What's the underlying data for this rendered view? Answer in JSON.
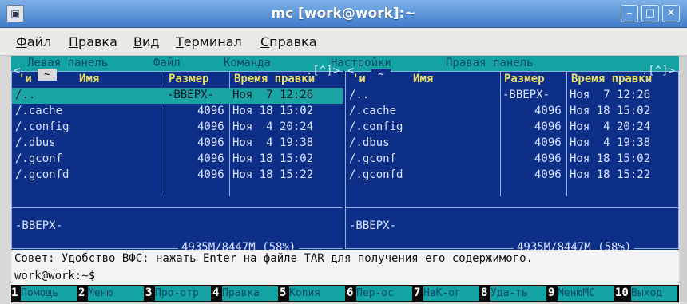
{
  "window": {
    "title": "mc [work@work]:~",
    "buttons": [
      "–",
      "□",
      "✕"
    ]
  },
  "menubar": {
    "items": [
      "Файл",
      "Правка",
      "Вид",
      "Терминал",
      "Справка"
    ]
  },
  "mc_menu": {
    "items": [
      "Левая панель",
      "Файл",
      "Команда",
      "Настройки",
      "Правая панель"
    ]
  },
  "left_panel": {
    "path_tab": "~",
    "title_right": ".[^]>",
    "headers": {
      "n": "'и",
      "name": "Имя",
      "size": "Размер",
      "time": "Время правки"
    },
    "rows": [
      {
        "name": "/..",
        "size": "-BBEPX-",
        "date": "Ноя  7 12:26",
        "selected": true
      },
      {
        "name": "/.cache",
        "size": "4096",
        "date": "Ноя 18 15:02"
      },
      {
        "name": "/.config",
        "size": "4096",
        "date": "Ноя  4 20:24"
      },
      {
        "name": "/.dbus",
        "size": "4096",
        "date": "Ноя  4 19:38"
      },
      {
        "name": "/.gconf",
        "size": "4096",
        "date": "Ноя 18 15:02"
      },
      {
        "name": "/.gconfd",
        "size": "4096",
        "date": "Ноя 18 15:22"
      }
    ],
    "status": "-BBEPX-",
    "disk": "4935M/8447M (58%)"
  },
  "right_panel": {
    "path_tab": "~",
    "title_right": ".[^]>",
    "headers": {
      "n": "'и",
      "name": "Имя",
      "size": "Размер",
      "time": "Время правки"
    },
    "rows": [
      {
        "name": "/..",
        "size": "-BBEPX-",
        "date": "Ноя  7 12:26"
      },
      {
        "name": "/.cache",
        "size": "4096",
        "date": "Ноя 18 15:02"
      },
      {
        "name": "/.config",
        "size": "4096",
        "date": "Ноя  4 20:24"
      },
      {
        "name": "/.dbus",
        "size": "4096",
        "date": "Ноя  4 19:38"
      },
      {
        "name": "/.gconf",
        "size": "4096",
        "date": "Ноя 18 15:02"
      },
      {
        "name": "/.gconfd",
        "size": "4096",
        "date": "Ноя 18 15:22"
      }
    ],
    "status": "-BBEPX-",
    "disk": "4935M/8447M (58%)"
  },
  "tip": "Совет: Удобство ВФС: нажать Enter на файле TAR для получения его содержимого.",
  "prompt": "work@work:~$",
  "fkeys": [
    {
      "num": "1",
      "label": "Помощь"
    },
    {
      "num": "2",
      "label": "Меню"
    },
    {
      "num": "3",
      "label": "Про-отр"
    },
    {
      "num": "4",
      "label": "Правка"
    },
    {
      "num": "5",
      "label": "Копия"
    },
    {
      "num": "6",
      "label": "Пер-ос"
    },
    {
      "num": "7",
      "label": "НвК-ог"
    },
    {
      "num": "8",
      "label": "Уда-ть"
    },
    {
      "num": "9",
      "label": "МенюМС"
    },
    {
      "num": "10",
      "label": "Выход"
    }
  ]
}
